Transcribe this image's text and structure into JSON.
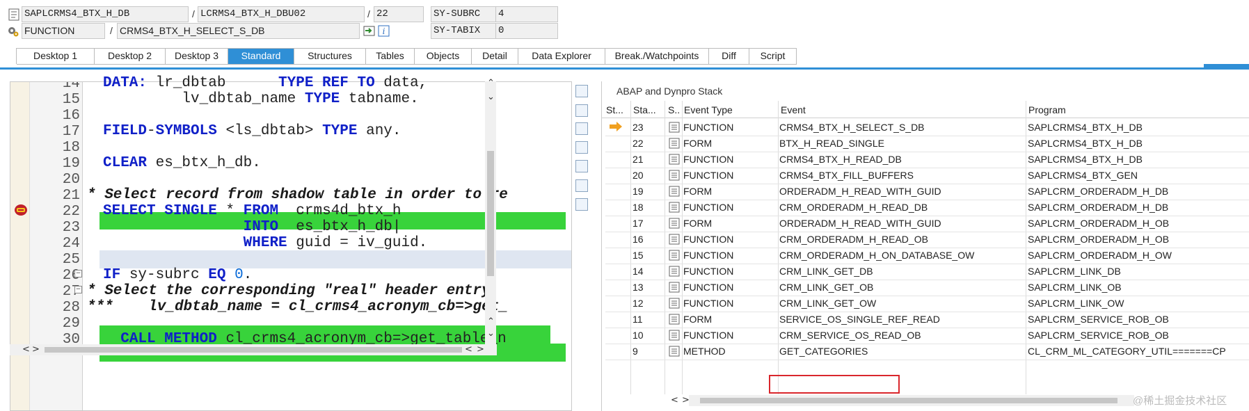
{
  "header": {
    "program": "SAPLCRMS4_BTX_H_DB",
    "sep1": "/",
    "include": "LCRMS4_BTX_H_DBU02",
    "sep2": "/",
    "line": "22",
    "subrc_label": "SY-SUBRC",
    "subrc_value": "4",
    "type": "FUNCTION",
    "sep3": "/",
    "name": "CRMS4_BTX_H_SELECT_S_DB",
    "tabix_label": "SY-TABIX",
    "tabix_value": "0"
  },
  "tabs": [
    {
      "label": "Desktop 1",
      "active": false
    },
    {
      "label": "Desktop 2",
      "active": false
    },
    {
      "label": "Desktop 3",
      "active": false
    },
    {
      "label": "Standard",
      "active": true
    },
    {
      "label": "Structures",
      "active": false
    },
    {
      "label": "Tables",
      "active": false
    },
    {
      "label": "Objects",
      "active": false
    },
    {
      "label": "Detail",
      "active": false
    },
    {
      "label": "Data Explorer",
      "active": false
    },
    {
      "label": "Break./Watchpoints",
      "active": false
    },
    {
      "label": "Diff",
      "active": false
    },
    {
      "label": "Script",
      "active": false
    }
  ],
  "editor": {
    "line_numbers": [
      "14",
      "15",
      "16",
      "17",
      "18",
      "19",
      "20",
      "21",
      "22",
      "23",
      "24",
      "25",
      "26",
      "27",
      "28",
      "29",
      "30"
    ],
    "breakpoint_icon": "breakpoint-icon",
    "current_line": "23"
  },
  "stack": {
    "title": "ABAP and Dynpro Stack",
    "columns": [
      "St...",
      "Sta...",
      "S..",
      "Event Type",
      "Event",
      "Program"
    ],
    "rows": [
      {
        "level": "23",
        "type": "FUNCTION",
        "event": "CRMS4_BTX_H_SELECT_S_DB",
        "program": "SAPLCRMS4_BTX_H_DB",
        "current": true
      },
      {
        "level": "22",
        "type": "FORM",
        "event": "BTX_H_READ_SINGLE",
        "program": "SAPLCRMS4_BTX_H_DB"
      },
      {
        "level": "21",
        "type": "FUNCTION",
        "event": "CRMS4_BTX_H_READ_DB",
        "program": "SAPLCRMS4_BTX_H_DB"
      },
      {
        "level": "20",
        "type": "FUNCTION",
        "event": "CRMS4_BTX_FILL_BUFFERS",
        "program": "SAPLCRMS4_BTX_GEN"
      },
      {
        "level": "19",
        "type": "FORM",
        "event": "ORDERADM_H_READ_WITH_GUID",
        "program": "SAPLCRM_ORDERADM_H_DB"
      },
      {
        "level": "18",
        "type": "FUNCTION",
        "event": "CRM_ORDERADM_H_READ_DB",
        "program": "SAPLCRM_ORDERADM_H_DB"
      },
      {
        "level": "17",
        "type": "FORM",
        "event": "ORDERADM_H_READ_WITH_GUID",
        "program": "SAPLCRM_ORDERADM_H_OB"
      },
      {
        "level": "16",
        "type": "FUNCTION",
        "event": "CRM_ORDERADM_H_READ_OB",
        "program": "SAPLCRM_ORDERADM_H_OB"
      },
      {
        "level": "15",
        "type": "FUNCTION",
        "event": "CRM_ORDERADM_H_ON_DATABASE_OW",
        "program": "SAPLCRM_ORDERADM_H_OW"
      },
      {
        "level": "14",
        "type": "FUNCTION",
        "event": "CRM_LINK_GET_DB",
        "program": "SAPLCRM_LINK_DB"
      },
      {
        "level": "13",
        "type": "FUNCTION",
        "event": "CRM_LINK_GET_OB",
        "program": "SAPLCRM_LINK_OB"
      },
      {
        "level": "12",
        "type": "FUNCTION",
        "event": "CRM_LINK_GET_OW",
        "program": "SAPLCRM_LINK_OW"
      },
      {
        "level": "11",
        "type": "FORM",
        "event": "SERVICE_OS_SINGLE_REF_READ",
        "program": "SAPLCRM_SERVICE_ROB_OB"
      },
      {
        "level": "10",
        "type": "FUNCTION",
        "event": "CRM_SERVICE_OS_READ_OB",
        "program": "SAPLCRM_SERVICE_ROB_OB"
      },
      {
        "level": "9",
        "type": "METHOD",
        "event": "GET_CATEGORIES",
        "program": "CL_CRM_ML_CATEGORY_UTIL=======CP"
      }
    ]
  },
  "watermark": "@稀土掘金技术社区",
  "colors": {
    "accent": "#2f8fd6",
    "highlight": "#38d33b",
    "keyword": "#1020c8",
    "marker": "#d9262c"
  }
}
